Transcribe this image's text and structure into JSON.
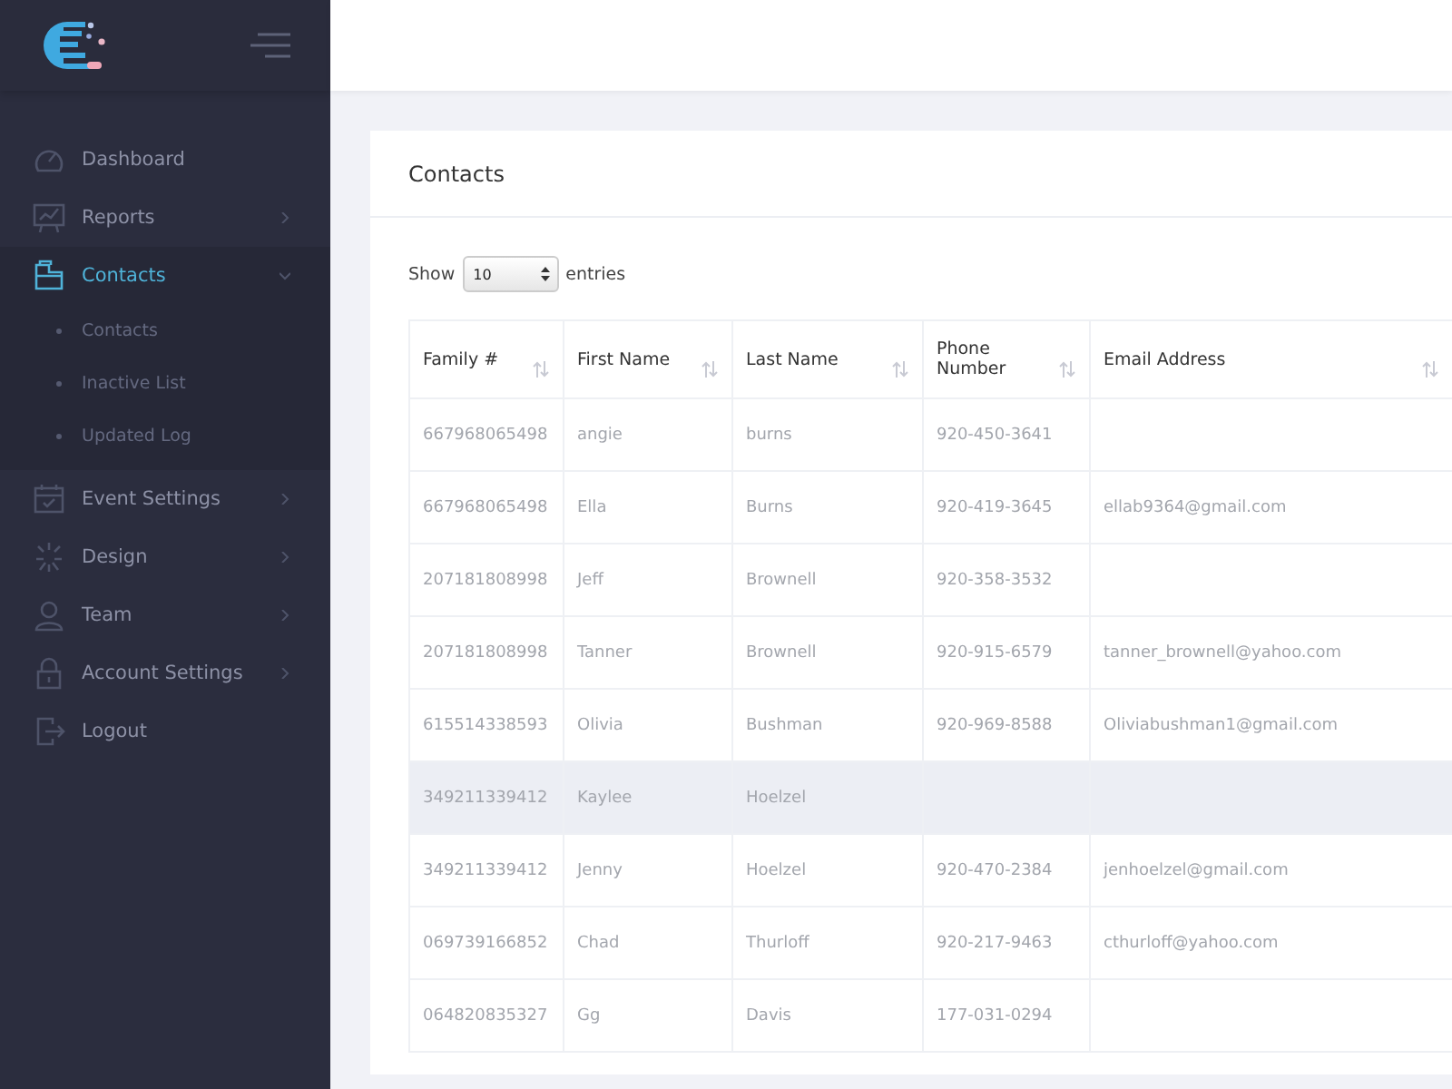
{
  "sidebar": {
    "items": [
      {
        "label": "Dashboard",
        "selected": false
      },
      {
        "label": "Reports",
        "selected": false,
        "expanded": false
      },
      {
        "label": "Contacts",
        "selected": true,
        "expanded": true,
        "children": [
          {
            "label": "Contacts"
          },
          {
            "label": "Inactive List"
          },
          {
            "label": "Updated Log"
          }
        ]
      },
      {
        "label": "Event Settings",
        "selected": false,
        "expanded": false
      },
      {
        "label": "Design",
        "selected": false,
        "expanded": false
      },
      {
        "label": "Team",
        "selected": false,
        "expanded": false
      },
      {
        "label": "Account Settings",
        "selected": false,
        "expanded": false
      },
      {
        "label": "Logout",
        "selected": false
      }
    ]
  },
  "card": {
    "title": "Contacts",
    "show_label": "Show",
    "page_size": "10",
    "entries_label": "entries"
  },
  "table": {
    "columns": [
      "Family #",
      "First Name",
      "Last Name",
      "Phone Number",
      "Email Address"
    ],
    "rows": [
      {
        "cells": [
          "667968065498",
          "angie",
          "burns",
          "920-450-3641",
          ""
        ],
        "highlighted": false
      },
      {
        "cells": [
          "667968065498",
          "Ella",
          "Burns",
          "920-419-3645",
          "ellab9364@gmail.com"
        ],
        "highlighted": false
      },
      {
        "cells": [
          "207181808998",
          "Jeff",
          "Brownell",
          "920-358-3532",
          ""
        ],
        "highlighted": false
      },
      {
        "cells": [
          "207181808998",
          "Tanner",
          "Brownell",
          "920-915-6579",
          "tanner_brownell@yahoo.com"
        ],
        "highlighted": false
      },
      {
        "cells": [
          "615514338593",
          "Olivia",
          "Bushman",
          "920-969-8588",
          "Oliviabushman1@gmail.com"
        ],
        "highlighted": false
      },
      {
        "cells": [
          "349211339412",
          "Kaylee",
          "Hoelzel",
          "",
          ""
        ],
        "highlighted": true
      },
      {
        "cells": [
          "349211339412",
          "Jenny",
          "Hoelzel",
          "920-470-2384",
          "jenhoelzel@gmail.com"
        ],
        "highlighted": false
      },
      {
        "cells": [
          "069739166852",
          "Chad",
          "Thurloff",
          "920-217-9463",
          "cthurloff@yahoo.com"
        ],
        "highlighted": false
      },
      {
        "cells": [
          "064820835327",
          "Gg",
          "Davis",
          "177-031-0294",
          ""
        ],
        "highlighted": false
      }
    ]
  }
}
